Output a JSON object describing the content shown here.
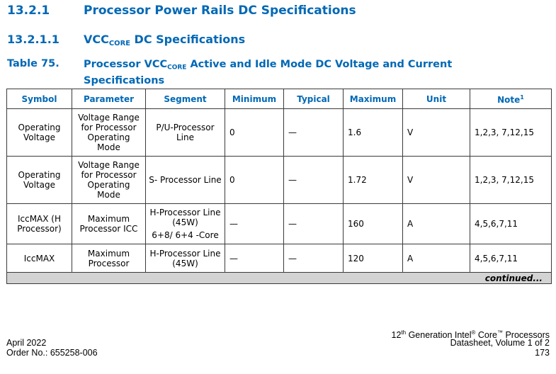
{
  "section": {
    "number": "13.2.1",
    "title": "Processor Power Rails DC Specifications"
  },
  "subsection": {
    "number": "13.2.1.1",
    "title_pre": "VCC",
    "title_sub": "CORE",
    "title_post": " DC Specifications"
  },
  "table": {
    "label": "Table 75.",
    "title_pre": "Processor VCC",
    "title_sub": "CORE",
    "title_post": " Active and Idle Mode DC Voltage and Current Specifications",
    "headers": [
      "Symbol",
      "Parameter",
      "Segment",
      "Minimum",
      "Typical",
      "Maximum",
      "Unit",
      "Note"
    ],
    "note_header_sup": "1",
    "rows": [
      {
        "symbol": "Operating Voltage",
        "parameter": "Voltage Range for Processor Operating Mode",
        "segment": "P/U-Processor Line",
        "segment_extra": "",
        "minimum": "0",
        "typical": "—",
        "maximum": "1.6",
        "unit": "V",
        "note": "1,2,3, 7,12,15"
      },
      {
        "symbol": "Operating Voltage",
        "parameter": "Voltage Range for Processor Operating Mode",
        "segment": "S- Processor Line",
        "segment_extra": "",
        "minimum": "0",
        "typical": "—",
        "maximum": "1.72",
        "unit": "V",
        "note": "1,2,3, 7,12,15"
      },
      {
        "symbol": "IccMAX (H Processor)",
        "parameter": "Maximum Processor ICC",
        "segment": "H-Processor Line (45W)",
        "segment_extra": "6+8/ 6+4 -Core",
        "minimum": "—",
        "typical": "—",
        "maximum": "160",
        "unit": "A",
        "note": "4,5,6,7,11"
      },
      {
        "symbol": "IccMAX",
        "parameter": "Maximum Processor",
        "segment": "H-Processor Line (45W)",
        "segment_extra": "",
        "minimum": "—",
        "typical": "—",
        "maximum": "120",
        "unit": "A",
        "note": "4,5,6,7,11"
      }
    ],
    "continued": "continued..."
  },
  "footer": {
    "date": "April 2022",
    "order": "Order No.: 655258-006",
    "product_pre": "12",
    "product_sup1": "th",
    "product_mid": " Generation Intel",
    "product_sup2": "®",
    "product_mid2": " Core",
    "product_sup3": "™",
    "product_post": " Processors",
    "doc": "Datasheet, Volume 1 of 2",
    "page": "173"
  }
}
